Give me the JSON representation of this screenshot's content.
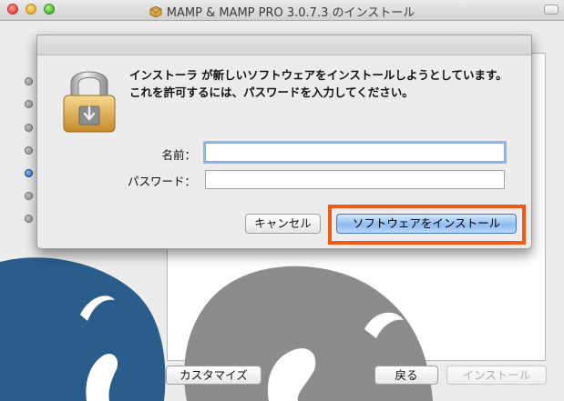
{
  "window": {
    "title": "MAMP & MAMP PRO 3.0.7.3 のインストール"
  },
  "footer": {
    "customize_label": "カスタマイズ",
    "back_label": "戻る",
    "install_label": "インストール"
  },
  "auth_dialog": {
    "message": "インストーラ が新しいソフトウェアをインストールしようとしています。 これを許可するには、パスワードを入力してください。",
    "name_label": "名前：",
    "name_value": "",
    "password_label": "パスワード：",
    "password_value": "",
    "cancel_label": "キャンセル",
    "confirm_label": "ソフトウェアをインストール"
  },
  "colors": {
    "highlight": "#ef5a17",
    "default_button": "#8fbcf0",
    "elephant_blue": "#2a5d8c",
    "elephant_gray": "#8c8c8c"
  },
  "icons": [
    "lock-icon",
    "package-icon"
  ]
}
